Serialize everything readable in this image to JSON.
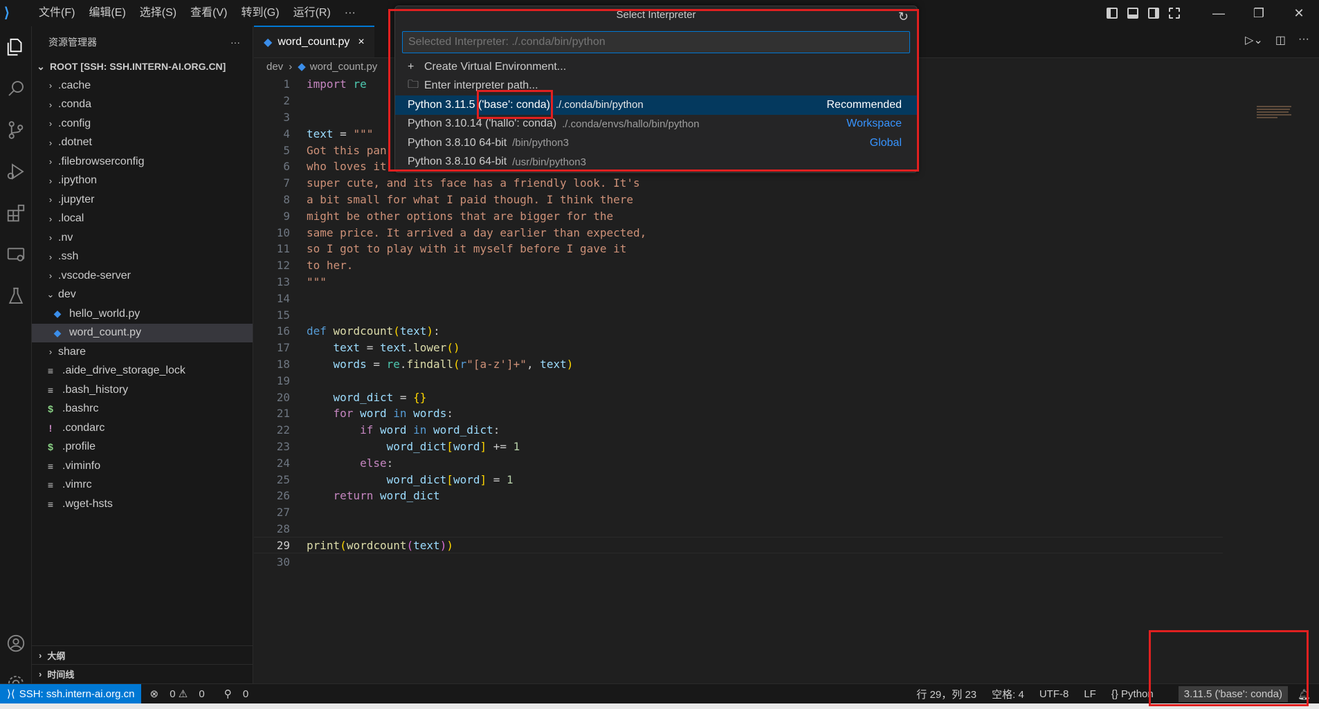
{
  "menu": [
    "文件(F)",
    "编辑(E)",
    "选择(S)",
    "查看(V)",
    "转到(G)",
    "运行(R)",
    "···"
  ],
  "sidebar": {
    "title": "资源管理器",
    "more": "···",
    "root": "ROOT [SSH: SSH.INTERN-AI.ORG.CN]",
    "items": [
      {
        "label": ".cache",
        "type": "folder"
      },
      {
        "label": ".conda",
        "type": "folder"
      },
      {
        "label": ".config",
        "type": "folder"
      },
      {
        "label": ".dotnet",
        "type": "folder"
      },
      {
        "label": ".filebrowserconfig",
        "type": "folder"
      },
      {
        "label": ".ipython",
        "type": "folder"
      },
      {
        "label": ".jupyter",
        "type": "folder"
      },
      {
        "label": ".local",
        "type": "folder"
      },
      {
        "label": ".nv",
        "type": "folder"
      },
      {
        "label": ".ssh",
        "type": "folder"
      },
      {
        "label": ".vscode-server",
        "type": "folder"
      },
      {
        "label": "dev",
        "type": "folder-open"
      },
      {
        "label": "hello_world.py",
        "type": "py"
      },
      {
        "label": "word_count.py",
        "type": "py"
      },
      {
        "label": "share",
        "type": "folder"
      },
      {
        "label": ".aide_drive_storage_lock",
        "type": "file"
      },
      {
        "label": ".bash_history",
        "type": "file"
      },
      {
        "label": ".bashrc",
        "type": "shell"
      },
      {
        "label": ".condarc",
        "type": "bang"
      },
      {
        "label": ".profile",
        "type": "shell"
      },
      {
        "label": ".viminfo",
        "type": "file"
      },
      {
        "label": ".vimrc",
        "type": "file"
      },
      {
        "label": ".wget-hsts",
        "type": "file"
      }
    ],
    "outline": "大纲",
    "timeline": "时间线"
  },
  "editor": {
    "tab": "word_count.py",
    "close": "×",
    "breadcrumb": [
      "dev",
      "word_count.py"
    ]
  },
  "code_lines": [
    "1",
    "2",
    "3",
    "4",
    "5",
    "6",
    "7",
    "8",
    "9",
    "10",
    "11",
    "12",
    "13",
    "14",
    "15",
    "16",
    "17",
    "18",
    "19",
    "20",
    "21",
    "22",
    "23",
    "24",
    "25",
    "26",
    "27",
    "28",
    "29",
    "30"
  ],
  "code_text": {
    "l1a": "import",
    "l1b": "re",
    "l4a": "text",
    "l4b": " = ",
    "l4c": "\"\"\"",
    "l5": "Got this pan",
    "l6": "who loves it",
    "l7": "super cute, and its face has a friendly look. It's",
    "l8": "a bit small for what I paid though. I think there",
    "l9": "might be other options that are bigger for the",
    "l10": "same price. It arrived a day earlier than expected,",
    "l11": "so I got to play with it myself before I gave it",
    "l12": "to her.",
    "l13": "\"\"\""
  },
  "quickpick": {
    "title": "Select Interpreter",
    "placeholder": "Selected Interpreter: ./.conda/bin/python",
    "items": [
      {
        "label": "Create Virtual Environment...",
        "desc": "",
        "tag": ""
      },
      {
        "label": "Enter interpreter path...",
        "desc": "",
        "tag": ""
      },
      {
        "label": "Python 3.11.5 ('base': conda)",
        "desc": "./.conda/bin/python",
        "tag": "Recommended"
      },
      {
        "label": "Python 3.10.14 ('hallo': conda)",
        "desc": "./.conda/envs/hallo/bin/python",
        "tag": "Workspace"
      },
      {
        "label": "Python 3.8.10 64-bit",
        "desc": "/bin/python3",
        "tag": "Global"
      },
      {
        "label": "Python 3.8.10 64-bit",
        "desc": "/usr/bin/python3",
        "tag": ""
      }
    ]
  },
  "status": {
    "remote": "SSH: ssh.intern-ai.org.cn",
    "errors": "0",
    "warnings": "0",
    "ports": "0",
    "position": "行 29，列 23",
    "spaces": "空格: 4",
    "encoding": "UTF-8",
    "eol": "LF",
    "language": "Python",
    "interpreter": "3.11.5 ('base': conda)"
  },
  "colors": {
    "accent": "#0078d4",
    "annotation": "#e02020"
  }
}
